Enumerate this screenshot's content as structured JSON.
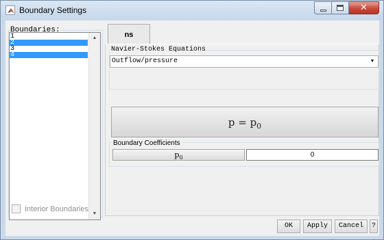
{
  "window": {
    "title": "Boundary Settings",
    "minimize_icon": "minimize-icon",
    "maximize_icon": "maximize-icon",
    "close_glyph": "✕"
  },
  "boundaries": {
    "label": "Boundaries:",
    "items": [
      "1",
      "2",
      "3",
      "4"
    ],
    "selected": [
      "2",
      "4"
    ],
    "interior_label": "Interior Boundaries"
  },
  "tab": {
    "label": "ns"
  },
  "ns_group": {
    "label": "Navier-Stokes Equations",
    "condition": "Outflow/pressure"
  },
  "equation": {
    "lhs": "p",
    "eq": "=",
    "rhs_base": "p",
    "rhs_sub": "0"
  },
  "coefficients": {
    "label": "Boundary Coefficients",
    "name_base": "p",
    "name_sub": "0",
    "value": "0"
  },
  "buttons": {
    "ok": "OK",
    "apply": "Apply",
    "cancel": "Cancel",
    "help": "?"
  },
  "colors": {
    "selection": "#3399ff",
    "close_button": "#c9483a"
  }
}
